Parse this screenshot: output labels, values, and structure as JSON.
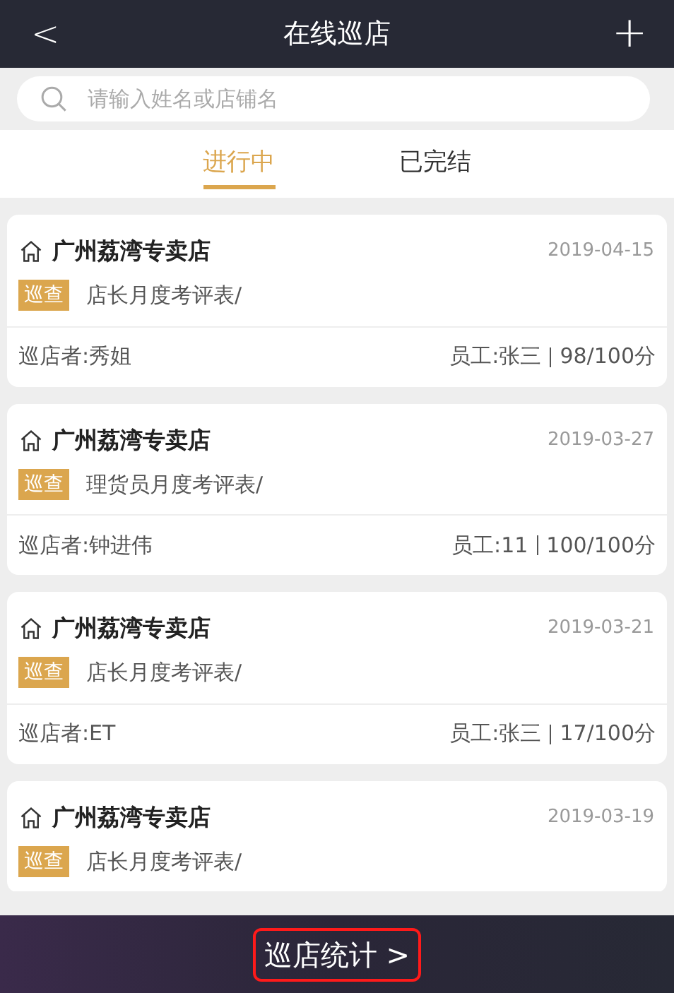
{
  "header": {
    "back": "<",
    "title": "在线巡店",
    "add": "+"
  },
  "search": {
    "placeholder": "请输入姓名或店铺名"
  },
  "tabs": [
    {
      "label": "进行中",
      "selected": true
    },
    {
      "label": "已完结",
      "selected": false
    }
  ],
  "cards": [
    {
      "store": "广州荔湾专卖店",
      "date": "2019-04-15",
      "tag": "巡查",
      "form": "店长月度考评表/",
      "inspector": "巡店者:秀姐",
      "staff": "员工:张三",
      "score": "98/100分"
    },
    {
      "store": "广州荔湾专卖店",
      "date": "2019-03-27",
      "tag": "巡查",
      "form": "理货员月度考评表/",
      "inspector": "巡店者:钟进伟",
      "staff": "员工:11",
      "score": "100/100分"
    },
    {
      "store": "广州荔湾专卖店",
      "date": "2019-03-21",
      "tag": "巡查",
      "form": "店长月度考评表/",
      "inspector": "巡店者:ET",
      "staff": "员工:张三",
      "score": "17/100分"
    },
    {
      "store": "广州荔湾专卖店",
      "date": "2019-03-19",
      "tag": "巡查",
      "form": "店长月度考评表/"
    }
  ],
  "footer_button": "巡店统计 >"
}
